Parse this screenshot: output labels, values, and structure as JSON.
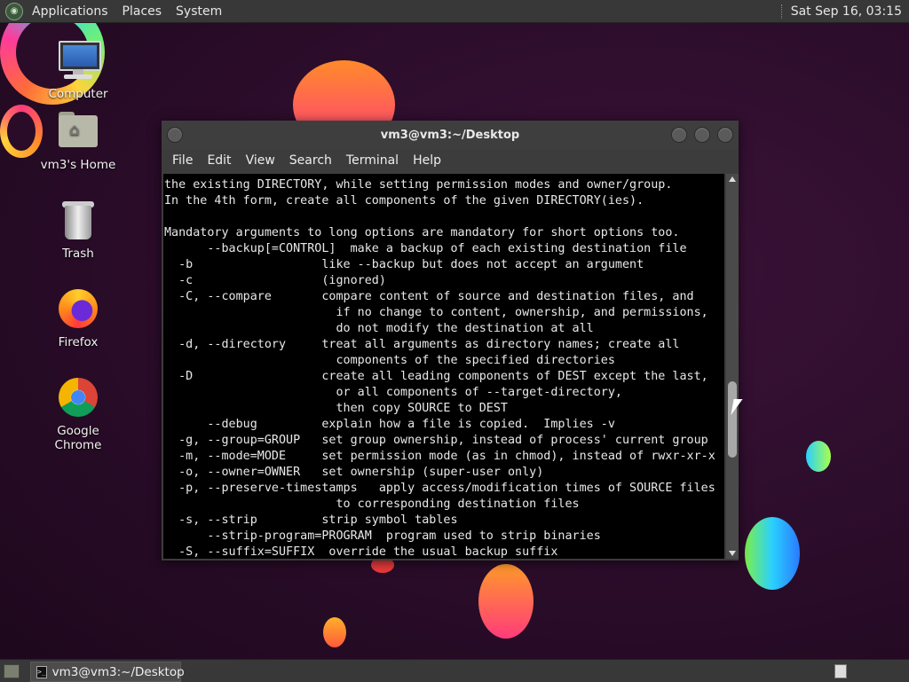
{
  "top_panel": {
    "menus": [
      "Applications",
      "Places",
      "System"
    ],
    "clock": "Sat Sep 16, 03:15"
  },
  "desktop_icons": [
    {
      "label": "Computer",
      "icon": "computer-icon"
    },
    {
      "label": "vm3's Home",
      "icon": "home-folder-icon"
    },
    {
      "label": "Trash",
      "icon": "trash-icon"
    },
    {
      "label": "Firefox",
      "icon": "firefox-icon"
    },
    {
      "label": "Google Chrome",
      "icon": "chrome-icon"
    }
  ],
  "terminal": {
    "title": "vm3@vm3:~/Desktop",
    "menus": [
      "File",
      "Edit",
      "View",
      "Search",
      "Terminal",
      "Help"
    ],
    "lines": [
      "the existing DIRECTORY, while setting permission modes and owner/group.",
      "In the 4th form, create all components of the given DIRECTORY(ies).",
      "",
      "Mandatory arguments to long options are mandatory for short options too.",
      "      --backup[=CONTROL]  make a backup of each existing destination file",
      "  -b                  like --backup but does not accept an argument",
      "  -c                  (ignored)",
      "  -C, --compare       compare content of source and destination files, and",
      "                        if no change to content, ownership, and permissions,",
      "                        do not modify the destination at all",
      "  -d, --directory     treat all arguments as directory names; create all",
      "                        components of the specified directories",
      "  -D                  create all leading components of DEST except the last,",
      "                        or all components of --target-directory,",
      "                        then copy SOURCE to DEST",
      "      --debug         explain how a file is copied.  Implies -v",
      "  -g, --group=GROUP   set group ownership, instead of process' current group",
      "  -m, --mode=MODE     set permission mode (as in chmod), instead of rwxr-xr-x",
      "  -o, --owner=OWNER   set ownership (super-user only)",
      "  -p, --preserve-timestamps   apply access/modification times of SOURCE files",
      "                        to corresponding destination files",
      "  -s, --strip         strip symbol tables",
      "      --strip-program=PROGRAM  program used to strip binaries",
      "  -S, --suffix=SUFFIX  override the usual backup suffix"
    ]
  },
  "bottom_panel": {
    "taskbar_item": "vm3@vm3:~/Desktop"
  }
}
